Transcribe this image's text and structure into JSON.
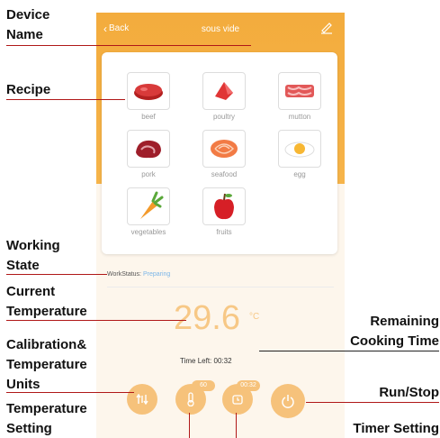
{
  "app": {
    "back_label": "Back",
    "title": "sous vide"
  },
  "recipes": [
    {
      "label": "beef",
      "icon": "beef-icon"
    },
    {
      "label": "poultry",
      "icon": "poultry-icon"
    },
    {
      "label": "mutton",
      "icon": "mutton-icon"
    },
    {
      "label": "pork",
      "icon": "pork-icon"
    },
    {
      "label": "seafood",
      "icon": "seafood-icon"
    },
    {
      "label": "egg",
      "icon": "egg-icon"
    },
    {
      "label": "vegetables",
      "icon": "vegetables-icon"
    },
    {
      "label": "fruits",
      "icon": "fruits-icon"
    }
  ],
  "status": {
    "label": "WorkStatus:",
    "value": "Preparing"
  },
  "temperature": {
    "value": "29.6",
    "unit": "°C"
  },
  "timer": {
    "label": "Time Left:",
    "value": "00:32"
  },
  "controls": {
    "temp_setting_badge": "60",
    "timer_setting_badge": "00:32"
  },
  "annotations": {
    "device_name": "Device Name",
    "recipe": "Recipe",
    "working_state": "Working State",
    "current_temperature": "Current Temperature",
    "calibration_units": "Calibration& Temperature Units",
    "temperature_setting": "Temperature Setting",
    "remaining_time": "Remaining Cooking Time",
    "run_stop": "Run/Stop",
    "timer_setting": "Timer Setting"
  },
  "colors": {
    "accent": "#f3ac3d",
    "annotation_line": "#b01818",
    "status_value": "#7bb6e8"
  }
}
